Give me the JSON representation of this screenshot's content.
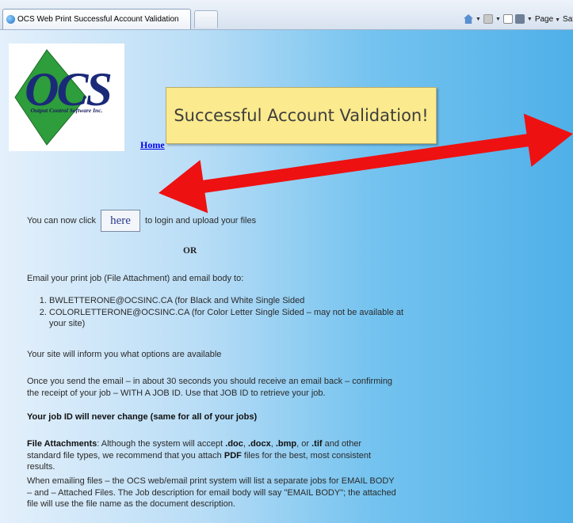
{
  "browser": {
    "tab_title": "OCS Web Print Successful Account Validation",
    "toolbar": {
      "page_label": "Page",
      "safety_label": "Safe"
    }
  },
  "logo": {
    "letters": "OCS",
    "tagline": "Output Control Software Inc."
  },
  "nav": {
    "home_link": "Home"
  },
  "banner": {
    "text": "Successful Account Validation!"
  },
  "content": {
    "click_prefix": "You can now click",
    "here_button": "here",
    "click_suffix": "to login and upload your files",
    "or": "OR",
    "email_intro": "Email your print job (File Attachment) and email body to:",
    "addresses": [
      "BWLETTERONE@OCSINC.CA (for Black and White Single Sided",
      "COLORLETTERONE@OCSINC.CA (for Color Letter Single Sided – may not be available at your site)"
    ],
    "site_info": "Your site will inform you what options are available",
    "once_send": "Once you send the email – in about 30 seconds you should receive an email back – confirming the receipt of your job – WITH A JOB ID. Use that JOB ID to retrieve your job.",
    "job_id_note": "Your job ID will never change (same for all of your jobs)",
    "attachments_heading": "File Attachments",
    "attachments_pre": ": Although the system will accept ",
    "ext_doc": ".doc",
    "sep1": ", ",
    "ext_docx": ".docx",
    "sep2": ", ",
    "ext_bmp": ".bmp",
    "sep3": ", or ",
    "ext_tif": ".tif",
    "attachments_mid": " and other standard file types, we recommend that you attach ",
    "pdf": "PDF",
    "attachments_post": " files for the best, most consistent results.",
    "emailing_files": "When emailing files – the OCS web/email print system will list a separate jobs for EMAIL BODY – and – Attached Files. The Job description for email body will say \"EMAIL BODY\"; the attached file will use the file name as the document description."
  },
  "annotation": {
    "arrow_color": "#ee1111"
  }
}
